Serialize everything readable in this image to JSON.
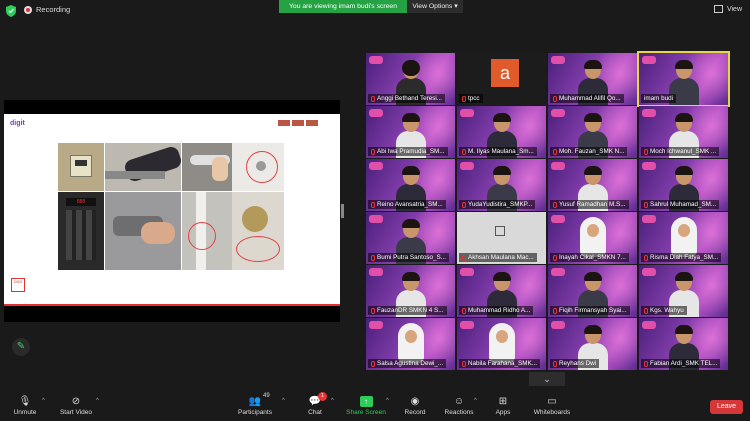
{
  "topbar": {
    "recording_label": "Recording",
    "viewing_banner": "You are viewing imam budi's screen",
    "view_options_label": "View Options",
    "view_label": "View"
  },
  "share": {
    "slide_logo": "digit",
    "stamp_text": "DIGI"
  },
  "gallery": {
    "participants": [
      {
        "name": "Anggi Bethand Teresi...",
        "type": "video-girl",
        "mic_muted": true
      },
      {
        "name": "tpcc",
        "type": "avatar",
        "avatar_letter": "a",
        "mic_muted": true
      },
      {
        "name": "Muhammad Alifil Qo...",
        "type": "video",
        "mic_muted": true
      },
      {
        "name": "imam budi",
        "type": "video-man",
        "mic_muted": false,
        "active": true
      },
      {
        "name": "Abi Iwa Pramudia_SM...",
        "type": "video",
        "mic_muted": true
      },
      {
        "name": "M. Ilyas Maulana_Sm...",
        "type": "video",
        "mic_muted": true
      },
      {
        "name": "Moh. Fauzan_SMK N...",
        "type": "video",
        "mic_muted": true
      },
      {
        "name": "Moch Ichwanul_SMK ...",
        "type": "video",
        "mic_muted": true
      },
      {
        "name": "Reino Avansatria_SM...",
        "type": "video",
        "mic_muted": true
      },
      {
        "name": "YudaYudistira_SMKP...",
        "type": "video",
        "mic_muted": true
      },
      {
        "name": "Yusuf Ramadhan M.S...",
        "type": "video",
        "mic_muted": true
      },
      {
        "name": "Sahrul Muhamad_SM...",
        "type": "video",
        "mic_muted": true
      },
      {
        "name": "Bumi Putra Santoso_S...",
        "type": "video",
        "mic_muted": true
      },
      {
        "name": "Akhsan Maulana Mac...",
        "type": "blank",
        "mic_muted": true
      },
      {
        "name": "Inayah Cikal_SMKN 7...",
        "type": "video-hijab",
        "mic_muted": true
      },
      {
        "name": "Risma Diah Fatya_SM...",
        "type": "video-hijab",
        "mic_muted": true
      },
      {
        "name": "FauzanDR SMKN 4 S...",
        "type": "video",
        "mic_muted": true
      },
      {
        "name": "Muhammad Ridho A...",
        "type": "video",
        "mic_muted": true
      },
      {
        "name": "Fiqih Firmansyah Syai...",
        "type": "video",
        "mic_muted": true
      },
      {
        "name": "Kgs. Wahyu",
        "type": "video",
        "mic_muted": true
      },
      {
        "name": "Salsa Agustina Dewi_...",
        "type": "video-hijab",
        "mic_muted": true
      },
      {
        "name": "Nabila Farahana_SMK...",
        "type": "video-hijab",
        "mic_muted": true
      },
      {
        "name": "Reyhans Dwi",
        "type": "video",
        "mic_muted": true
      },
      {
        "name": "Fabian Ardi_SMK TEL...",
        "type": "video",
        "mic_muted": true
      }
    ]
  },
  "toolbar": {
    "unmute_label": "Unmute",
    "start_video_label": "Start Video",
    "participants_label": "Participants",
    "participants_count": "49",
    "chat_label": "Chat",
    "chat_badge": "1",
    "share_screen_label": "Share Screen",
    "record_label": "Record",
    "reactions_label": "Reactions",
    "apps_label": "Apps",
    "whiteboards_label": "Whiteboards",
    "leave_label": "Leave"
  },
  "colors": {
    "background": "#1a1a1a",
    "viewing_banner": "#25a244",
    "leave": "#d6383a",
    "active_speaker": "#e8d64a",
    "share_accent": "#2ecc5a"
  }
}
